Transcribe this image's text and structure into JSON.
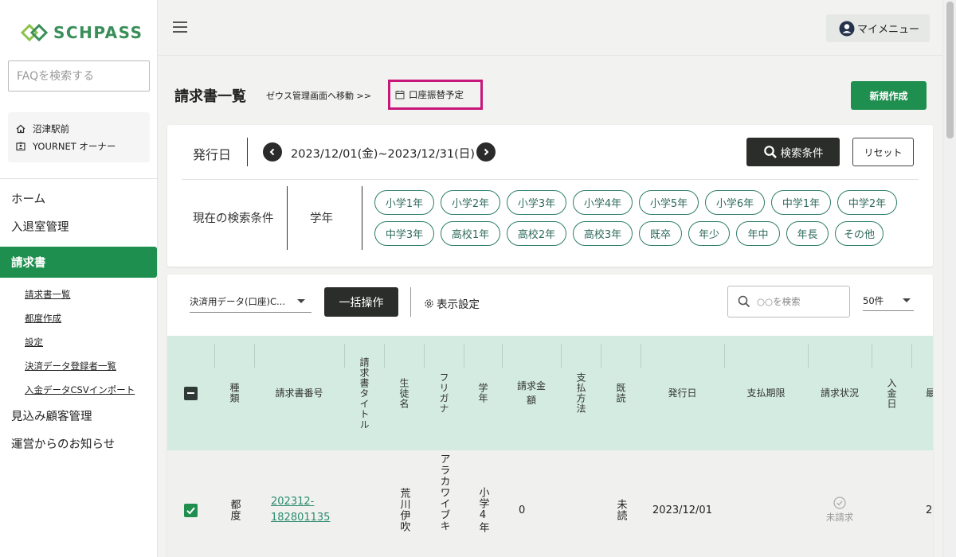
{
  "sidebar": {
    "logo_text": "SCHPASS",
    "faq_placeholder": "FAQを検索する",
    "account": {
      "location": "沼津駅前",
      "user": "YOURNET オーナー"
    },
    "nav": {
      "home": "ホーム",
      "attendance": "入退室管理",
      "invoice": "請求書",
      "sub": [
        "請求書一覧",
        "都度作成",
        "設定",
        "決済データ登録者一覧",
        "入金データCSVインポート"
      ],
      "prospects": "見込み顧客管理",
      "notices": "運営からのお知らせ"
    }
  },
  "header": {
    "mymenu": "マイメニュー"
  },
  "page": {
    "title": "請求書一覧",
    "zeus_link": "ゼウス管理画面へ移動 >>",
    "schedule": "口座振替予定",
    "new_button": "新規作成"
  },
  "filter": {
    "date_label": "発行日",
    "date_range": "2023/12/01(金)~2023/12/31(日)",
    "search_button": "検索条件",
    "reset_button": "リセット",
    "current_label": "現在の検索条件",
    "grade_label": "学年",
    "chips": [
      "小学1年",
      "小学2年",
      "小学3年",
      "小学4年",
      "小学5年",
      "小学6年",
      "中学1年",
      "中学2年",
      "中学3年",
      "高校1年",
      "高校2年",
      "高校3年",
      "既卒",
      "年少",
      "年中",
      "年長",
      "その他"
    ]
  },
  "table": {
    "payment_select": "決済用データ(口座)C...",
    "bulk_button": "一括操作",
    "display_settings": "表示設定",
    "search_placeholder": "○○を検索",
    "per_page": "50件",
    "columns": [
      "種類",
      "請求書番号",
      "請求書タイトル",
      "生徒名",
      "フリガナ",
      "学年",
      "請求金額",
      "支払方法",
      "既読",
      "発行日",
      "支払期限",
      "請求状況",
      "入金日",
      "最"
    ],
    "rows": [
      {
        "type": "都度",
        "number_line1": "202312-",
        "number_line2": "182801135",
        "student": "荒川伊吹",
        "furigana": "アラカワイブキ",
        "grade": "小学4年",
        "amount": "0",
        "read": "未読",
        "issued": "2023/12/01",
        "status": "未請求",
        "deposit": "2"
      }
    ]
  },
  "colors": {
    "brand": "#1f8f4f",
    "highlight": "#c8177a",
    "header_bg": "#d3ebe0",
    "chip": "#2e7d6a"
  }
}
